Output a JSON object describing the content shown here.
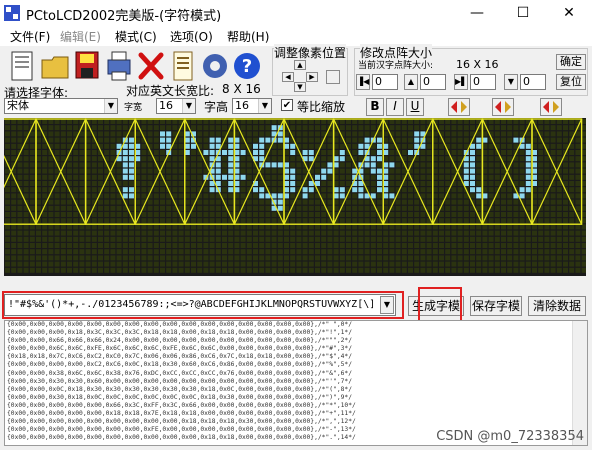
{
  "window": {
    "title": "PCtoLCD2002完美版-(字符模式)",
    "minimize": "—",
    "maximize": "☐",
    "close": "✕"
  },
  "menu": [
    "文件(F)",
    "编辑(E)",
    "模式(C)",
    "选项(O)",
    "帮助(H)"
  ],
  "toolbar": {
    "font_label": "请选择字体:",
    "font_value": "宋体",
    "en_ratio_label": "对应英文长宽比:",
    "en_ratio_value": "8 X 16",
    "width_label": "字宽",
    "width_value": "16",
    "height_label": "字高",
    "height_value": "16",
    "scale_label": "等比缩放",
    "scale_checked": "✔",
    "bold": "B",
    "italic": "I",
    "underline": "U",
    "adjust_title": "调整像素位置",
    "resize_title": "修改点阵大小",
    "current_size_label": "当前汉字点阵大小:",
    "current_size_value": "16 X 16",
    "confirm_label": "确定",
    "restore_label": "复位",
    "spin_values": [
      "0",
      "0",
      "0",
      "0"
    ]
  },
  "input": {
    "text": "!\"#$%&'()*+,-./0123456789:;<=>?@ABCDEFGHIJKLMNOPQRSTUVWXYZ[\\]"
  },
  "buttons": {
    "generate": "生成字模",
    "save": "保存字模",
    "clear": "清除数据"
  },
  "output_lines": [
    "{0x00,0x00,0x00,0x00,0x00,0x00,0x00,0x00,0x00,0x00,0x00,0x00,0x00,0x00,0x00,0x00},/*\" \",0*/",
    "{0x00,0x00,0x00,0x18,0x3C,0x3C,0x3C,0x18,0x18,0x00,0x18,0x18,0x00,0x00,0x00,0x00},/*\"!\",1*/",
    "{0x00,0x00,0x66,0x66,0x66,0x24,0x00,0x00,0x00,0x00,0x00,0x00,0x00,0x00,0x00,0x00},/*\"\"\",2*/",
    "{0x00,0x00,0x6C,0x6C,0xFE,0x6C,0x6C,0x6C,0xFE,0x6C,0x6C,0x00,0x00,0x00,0x00,0x00},/*\"#\",3*/",
    "{0x18,0x18,0x7C,0xC6,0xC2,0xC0,0x7C,0x06,0x06,0x86,0xC6,0x7C,0x18,0x18,0x00,0x00},/*\"$\",4*/",
    "{0x00,0x00,0x00,0x00,0xC2,0xC6,0x0C,0x18,0x30,0x60,0xC6,0x86,0x00,0x00,0x00,0x00},/*\"%\",5*/",
    "{0x00,0x00,0x38,0x6C,0x6C,0x38,0x76,0xDC,0xCC,0xCC,0xCC,0x76,0x00,0x00,0x00,0x00},/*\"&\",6*/",
    "{0x00,0x30,0x30,0x30,0x60,0x00,0x00,0x00,0x00,0x00,0x00,0x00,0x00,0x00,0x00,0x00},/*\"'\",7*/",
    "{0x00,0x00,0x0C,0x18,0x30,0x30,0x30,0x30,0x30,0x30,0x18,0x0C,0x00,0x00,0x00,0x00},/*\"(\",8*/",
    "{0x00,0x00,0x30,0x18,0x0C,0x0C,0x0C,0x0C,0x0C,0x0C,0x18,0x30,0x00,0x00,0x00,0x00},/*\")\",9*/",
    "{0x00,0x00,0x00,0x00,0x00,0x66,0x3C,0xFF,0x3C,0x66,0x00,0x00,0x00,0x00,0x00,0x00},/*\"*\",10*/",
    "{0x00,0x00,0x00,0x00,0x00,0x18,0x18,0x7E,0x18,0x18,0x00,0x00,0x00,0x00,0x00,0x00},/*\"+\",11*/",
    "{0x00,0x00,0x00,0x00,0x00,0x00,0x00,0x00,0x00,0x18,0x18,0x18,0x30,0x00,0x00,0x00},/*\",\",12*/",
    "{0x00,0x00,0x00,0x00,0x00,0x00,0x00,0xFE,0x00,0x00,0x00,0x00,0x00,0x00,0x00,0x00},/*\"-\",13*/",
    "{0x00,0x00,0x00,0x00,0x00,0x00,0x00,0x00,0x00,0x00,0x18,0x18,0x00,0x00,0x00,0x00},/*\".\",14*/"
  ],
  "watermark": "CSDN @m0_72338354",
  "colors": {
    "grid_bg": "#1a1a1a",
    "grid_line": "#4a5a1a",
    "cell_off": "#2b3310",
    "cell_on": "#8fd8ee",
    "cell_border": "#e8e820",
    "highlight": "#e02020"
  }
}
